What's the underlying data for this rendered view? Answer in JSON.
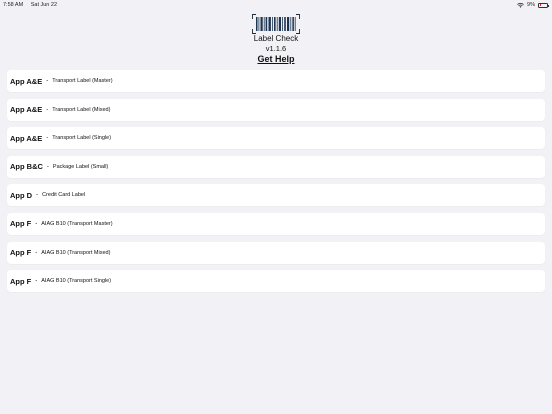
{
  "status_bar": {
    "time": "7:58 AM",
    "date": "Sat Jun 22",
    "battery": "9%",
    "battery_level": 0.09,
    "icons": [
      "wifi-icon",
      "battery-icon"
    ]
  },
  "header": {
    "logo_icon": "barcode-icon",
    "title": "Label Check",
    "version": "v1.1.6",
    "help_label": "Get Help"
  },
  "labels": [
    {
      "app": "App A&E",
      "sep": "-",
      "desc": "Transport Label (Master)"
    },
    {
      "app": "App A&E",
      "sep": "-",
      "desc": "Transport Label (Mixed)"
    },
    {
      "app": "App A&E",
      "sep": "-",
      "desc": "Transport Label (Single)"
    },
    {
      "app": "App B&C",
      "sep": "-",
      "desc": "Package Label (Small)"
    },
    {
      "app": "App D",
      "sep": "-",
      "desc": "Credit Card Label"
    },
    {
      "app": "App F",
      "sep": "-",
      "desc": "AIAG B10 (Transport Master)"
    },
    {
      "app": "App F",
      "sep": "-",
      "desc": "AIAG B10 (Transport Mixed)"
    },
    {
      "app": "App F",
      "sep": "-",
      "desc": "AIAG B10 (Transport Single)"
    }
  ],
  "colors": {
    "background": "#f2f2f6",
    "card": "#ffffff",
    "battery_low": "#e22222"
  }
}
